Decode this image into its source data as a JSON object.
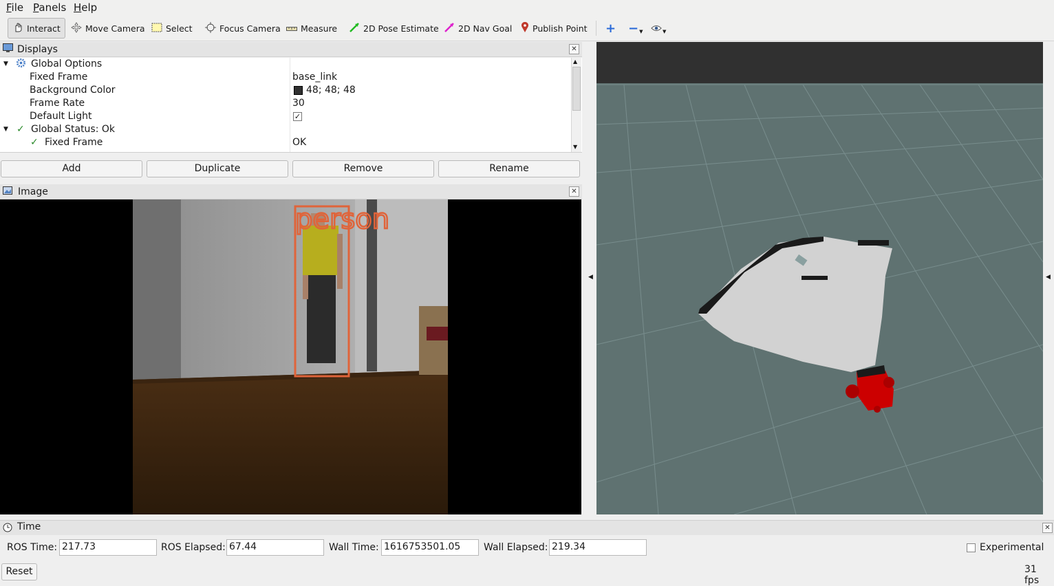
{
  "menu": [
    "File",
    "Panels",
    "Help"
  ],
  "toolbar": {
    "tools": [
      {
        "label": "Interact",
        "icon": "hand-icon",
        "active": true
      },
      {
        "label": "Move Camera",
        "icon": "move-camera-icon"
      },
      {
        "label": "Select",
        "icon": "select-icon"
      },
      {
        "label": "Focus Camera",
        "icon": "focus-camera-icon"
      },
      {
        "label": "Measure",
        "icon": "ruler-icon"
      },
      {
        "label": "2D Pose Estimate",
        "icon": "green-arrow-icon"
      },
      {
        "label": "2D Nav Goal",
        "icon": "magenta-arrow-icon"
      },
      {
        "label": "Publish Point",
        "icon": "map-pin-icon"
      }
    ],
    "extra_icons": [
      "plus-icon",
      "minus-icon",
      "eye-icon"
    ]
  },
  "displays": {
    "title": "Displays",
    "rows": [
      {
        "key": "Global Options",
        "value": ""
      },
      {
        "key": "Fixed Frame",
        "value": "base_link"
      },
      {
        "key": "Background Color",
        "value": "48; 48; 48"
      },
      {
        "key": "Frame Rate",
        "value": "30"
      },
      {
        "key": "Default Light",
        "value": "✓"
      },
      {
        "key": "Global Status: Ok",
        "value": ""
      },
      {
        "key": "Fixed Frame",
        "value": "OK"
      }
    ],
    "buttons": [
      "Add",
      "Duplicate",
      "Remove",
      "Rename"
    ]
  },
  "image_panel": {
    "title": "Image",
    "detection_label": "person"
  },
  "time": {
    "title": "Time",
    "ros_time_label": "ROS Time:",
    "ros_time": "217.73",
    "ros_elapsed_label": "ROS Elapsed:",
    "ros_elapsed": "67.44",
    "wall_time_label": "Wall Time:",
    "wall_time": "1616753501.05",
    "wall_elapsed_label": "Wall Elapsed:",
    "wall_elapsed": "219.34",
    "experimental_label": "Experimental",
    "reset_label": "Reset",
    "fps": "31 fps"
  },
  "colors": {
    "background": "#5f7271",
    "detection_box": "#e0643a",
    "robot": "#cc0000",
    "laser_scan": "#d2d2d2"
  }
}
